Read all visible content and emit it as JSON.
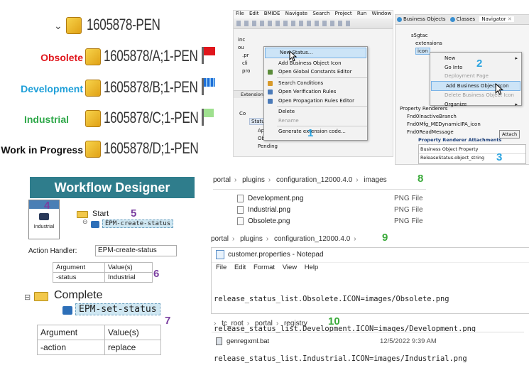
{
  "revisions": {
    "root": "1605878-PEN",
    "items": [
      {
        "status": "Obsolete",
        "rev": "1605878/A;1-PEN",
        "color": "#e0161c"
      },
      {
        "status": "Development",
        "rev": "1605878/B;1-PEN",
        "color": "#1e9fd8"
      },
      {
        "status": "Industrial",
        "rev": "1605878/C;1-PEN",
        "color": "#2fa84a"
      },
      {
        "status": "Work in Progress",
        "rev": "1605878/D;1-PEN",
        "color": "#111111"
      }
    ]
  },
  "eclipse": {
    "menubar": [
      "File",
      "Edit",
      "BMIDE",
      "Navigate",
      "Search",
      "Project",
      "Run",
      "Window"
    ],
    "tree": [
      "inc",
      "ou",
      ".pr",
      "cli",
      "pro"
    ],
    "extension_tab": "Extension",
    "context_menu": [
      "New Status...",
      "Add Business Object Icon",
      "Open Global Constants Editor",
      "Search Conditions",
      "Open Verification Rules",
      "Open Propagation Rules Editor",
      "Delete",
      "Rename",
      "Generate extension code..."
    ],
    "status_tree": {
      "root": "Co",
      "folder": "Status",
      "children": [
        "Approved",
        "Obsolete",
        "Pending"
      ]
    }
  },
  "navigator": {
    "tabs": [
      "Business Objects",
      "Classes",
      "Navigator"
    ],
    "tree": [
      "s5gtac",
      "extensions",
      "icon"
    ],
    "context_menu": [
      "New",
      "Go Into",
      "Deployment Page",
      "Add Business Object Icon",
      "Delete Business Object Icon",
      "Organize"
    ],
    "property_renderers": "Property Renderers",
    "renderers": [
      "Fnd0InactiveBranch",
      "Fnd0Mfg_MEDynamicIPA_icon",
      "Fnd0ReadMessage"
    ],
    "attachments_title": "Property Renderer Attachments",
    "attach_button": "Attach",
    "bo_property_label": "Business Object Property",
    "bo_property_value": "ReleaseStatus.object_string"
  },
  "workflow": {
    "title": "Workflow Designer",
    "node_label": "Industrial",
    "start_label": "Start",
    "task_create": "EPM-create-status",
    "action_handler_label": "Action Handler:",
    "action_handler_value": "EPM-create-status",
    "args_small": {
      "headers": [
        "Argument",
        "Value(s)"
      ],
      "rows": [
        [
          "-status",
          "Industrial"
        ]
      ]
    },
    "complete_label": "Complete",
    "task_set": "EPM-set-status",
    "args_large": {
      "headers": [
        "Argument",
        "Value(s)"
      ],
      "rows": [
        [
          "-action",
          "replace"
        ]
      ]
    }
  },
  "images_folder": {
    "breadcrumb": [
      "portal",
      "plugins",
      "configuration_12000.4.0",
      "images"
    ],
    "files": [
      {
        "name": "Development.png",
        "type": "PNG File"
      },
      {
        "name": "Industrial.png",
        "type": "PNG File"
      },
      {
        "name": "Obsolete.png",
        "type": "PNG File"
      }
    ]
  },
  "config_folder": {
    "breadcrumb": [
      "portal",
      "plugins",
      "configuration_12000.4.0"
    ]
  },
  "notepad": {
    "title": "customer.properties - Notepad",
    "menu": [
      "File",
      "Edit",
      "Format",
      "View",
      "Help"
    ],
    "lines": [
      "release_status_list.Obsolete.ICON=images/Obsolete.png",
      "release_status_list.Development.ICON=images/Development.png",
      "release_status_list.Industrial.ICON=images/Industrial.png"
    ]
  },
  "registry_folder": {
    "breadcrumb": [
      "tc_root",
      "portal",
      "registry"
    ],
    "file": {
      "name": "genregxml.bat",
      "date": "12/5/2022 9:39 AM"
    }
  },
  "step_numbers": [
    "1",
    "2",
    "3",
    "4",
    "5",
    "6",
    "7",
    "8",
    "9",
    "10"
  ],
  "colors": {
    "step_blue": "#29a3e0",
    "step_purple": "#7b3fa0",
    "step_green": "#3aaa3a",
    "workflow_header_bg": "#2f7d8c",
    "menu_highlight": "#cce4f7"
  }
}
